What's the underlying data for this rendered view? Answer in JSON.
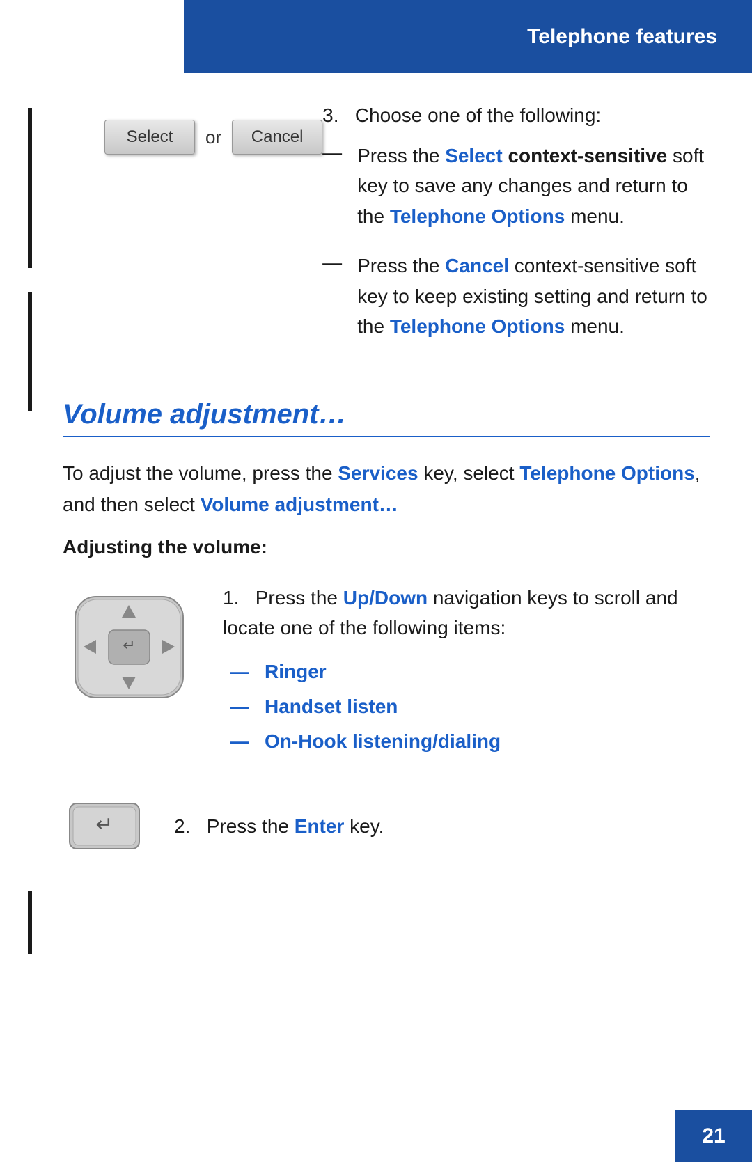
{
  "header": {
    "title": "Telephone features",
    "background": "#1a4fa0"
  },
  "step3": {
    "label": "3.",
    "intro": "Choose one of the following:"
  },
  "softkeys": {
    "select_label": "Select",
    "cancel_label": "Cancel",
    "or_text": "or"
  },
  "bullets": [
    {
      "dash": "—",
      "parts": [
        {
          "text": "Press the ",
          "plain": true
        },
        {
          "text": "Select",
          "bold_blue": true
        },
        {
          "text": " ",
          "plain": true
        },
        {
          "text": "context-sensitive",
          "bold": true
        },
        {
          "text": " soft key to save any changes and return to the ",
          "plain": true
        },
        {
          "text": "Telephone Options",
          "blue_bold": true
        },
        {
          "text": " menu.",
          "plain": true
        }
      ]
    },
    {
      "dash": "—",
      "parts": [
        {
          "text": "Press the ",
          "plain": true
        },
        {
          "text": "Cancel",
          "bold_blue": true
        },
        {
          "text": " context-sensitive soft key to keep existing setting and return to the ",
          "plain": true
        },
        {
          "text": "Telephone Options",
          "blue_bold": true
        },
        {
          "text": " menu.",
          "plain": true
        }
      ]
    }
  ],
  "volume_section": {
    "heading": "Volume adjustment…",
    "intro_plain1": "To adjust the volume, press the ",
    "intro_services": "Services",
    "intro_plain2": " key, select ",
    "intro_telephone": "Telephone Options",
    "intro_plain3": ", and then select ",
    "intro_volume": "Volume adjustment…",
    "sub_heading": "Adjusting the volume:"
  },
  "step1": {
    "number": "1.",
    "plain1": "Press the ",
    "up_down": "Up/Down",
    "plain2": " navigation keys to scroll and locate one of the following items:",
    "items": [
      {
        "dash": "—",
        "label": "Ringer"
      },
      {
        "dash": "—",
        "label": "Handset listen"
      },
      {
        "dash": "—",
        "label": "On-Hook listening/dialing"
      }
    ]
  },
  "step2": {
    "number": "2.",
    "plain1": "Press the ",
    "enter": "Enter",
    "plain2": " key."
  },
  "footer": {
    "page": "21"
  }
}
